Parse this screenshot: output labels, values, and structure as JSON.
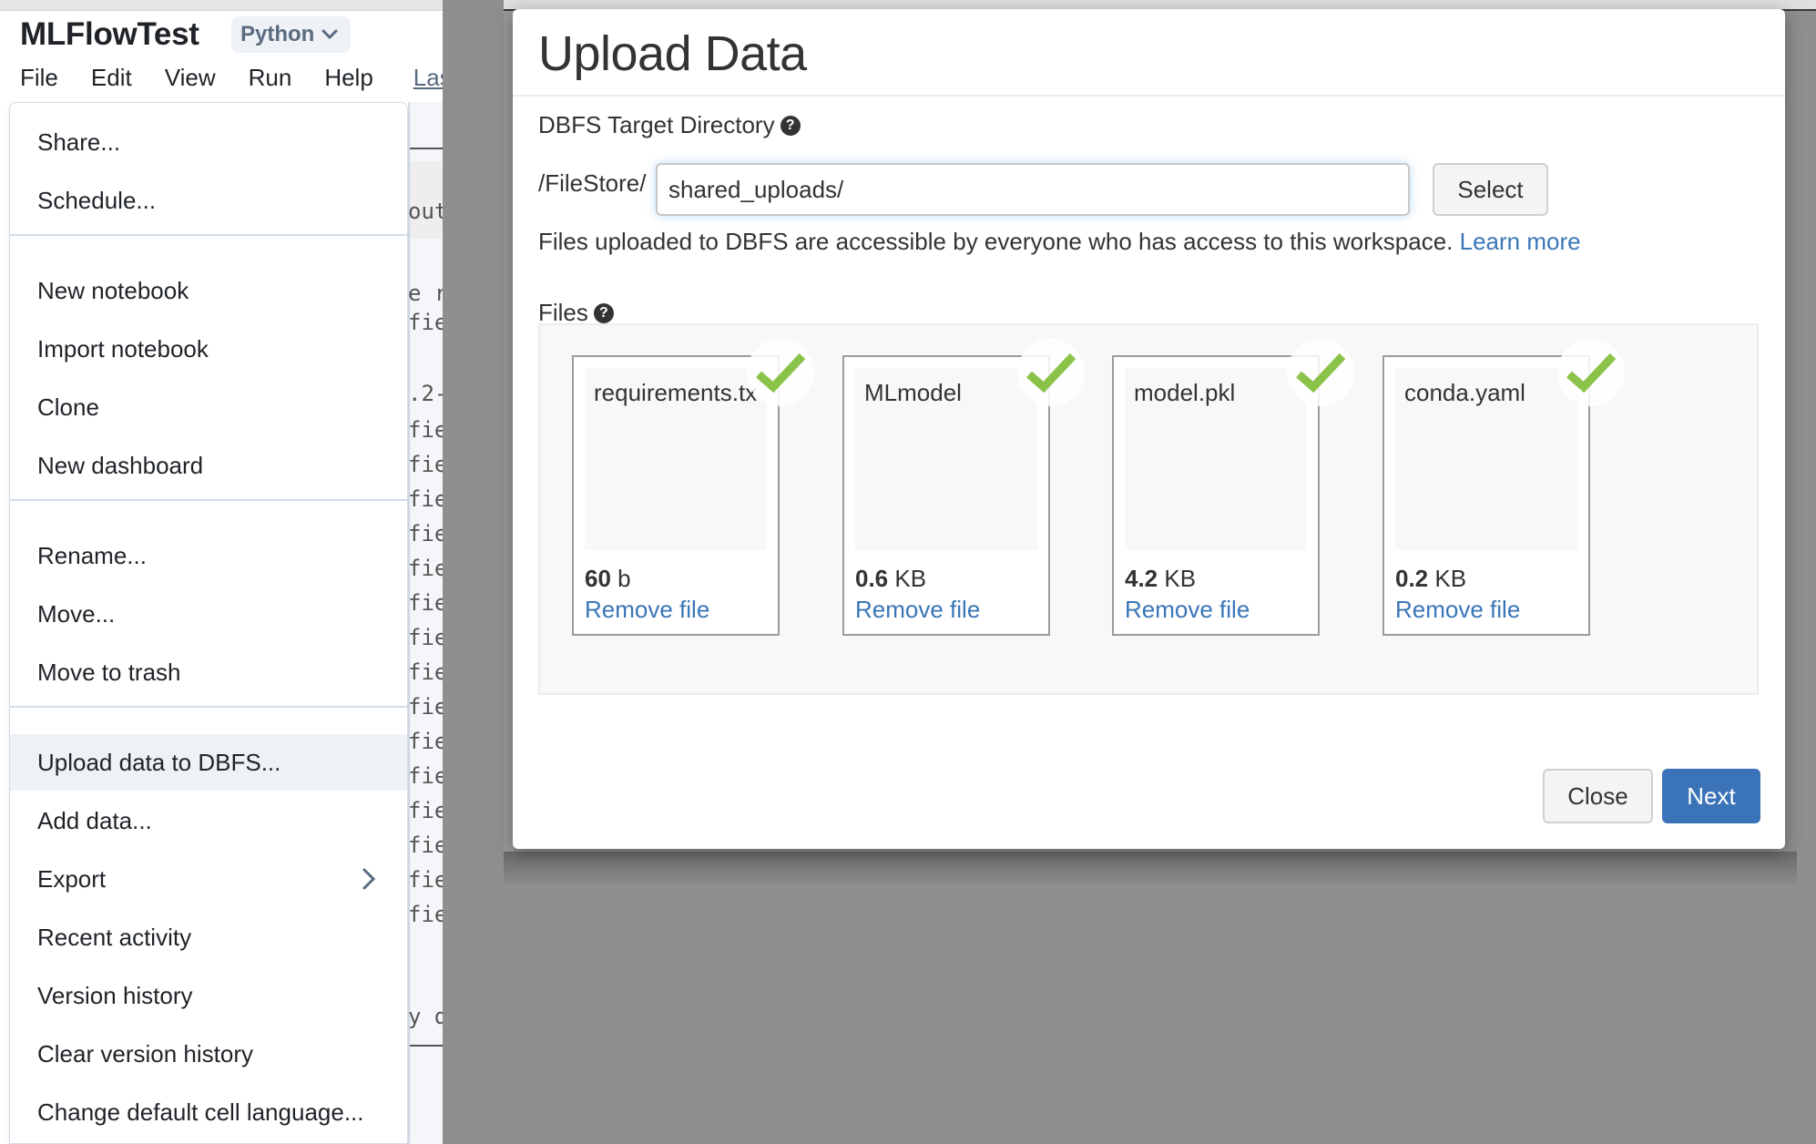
{
  "notebook": {
    "title": "MLFlowTest",
    "language": "Python",
    "menubar": [
      "File",
      "Edit",
      "View",
      "Run",
      "Help"
    ],
    "last_link": "Las",
    "code_fragments": [
      "out",
      "e r",
      "fie",
      ".2-",
      "fie",
      "fie",
      "fie",
      "fie",
      "fie",
      "fie",
      "fie",
      "fie",
      "fie",
      "fie",
      "fie",
      "fie",
      "fie",
      "fie",
      "fie",
      "y d"
    ]
  },
  "file_menu": {
    "groups": [
      [
        "Share...",
        "Schedule..."
      ],
      [
        "New notebook",
        "Import notebook",
        "Clone",
        "New dashboard"
      ],
      [
        "Rename...",
        "Move...",
        "Move to trash"
      ],
      [
        "Upload data to DBFS...",
        "Add data...",
        "Export",
        "Recent activity",
        "Version history",
        "Clear version history",
        "Change default cell language..."
      ]
    ],
    "highlighted": "Upload data to DBFS...",
    "submenu_item": "Export"
  },
  "modal": {
    "title": "Upload Data",
    "target_dir_label": "DBFS Target Directory",
    "dir_prefix": "/FileStore/",
    "dir_value": "shared_uploads/",
    "select_label": "Select",
    "notice": "Files uploaded to DBFS are accessible by everyone who has access to this workspace.",
    "learn_more": "Learn more",
    "files_label": "Files",
    "files": [
      {
        "name": "requirements.txt",
        "size_value": "60",
        "size_unit": "b",
        "remove": "Remove file",
        "uploaded": true
      },
      {
        "name": "MLmodel",
        "size_value": "0.6",
        "size_unit": "KB",
        "remove": "Remove file",
        "uploaded": true
      },
      {
        "name": "model.pkl",
        "size_value": "4.2",
        "size_unit": "KB",
        "remove": "Remove file",
        "uploaded": true
      },
      {
        "name": "conda.yaml",
        "size_value": "0.2",
        "size_unit": "KB",
        "remove": "Remove file",
        "uploaded": true
      }
    ],
    "close_label": "Close",
    "next_label": "Next"
  },
  "colors": {
    "accent": "#3b73b9",
    "link": "#3a76b8",
    "success_check": "#8bc34a",
    "menu_highlight": "#eef2f7"
  }
}
